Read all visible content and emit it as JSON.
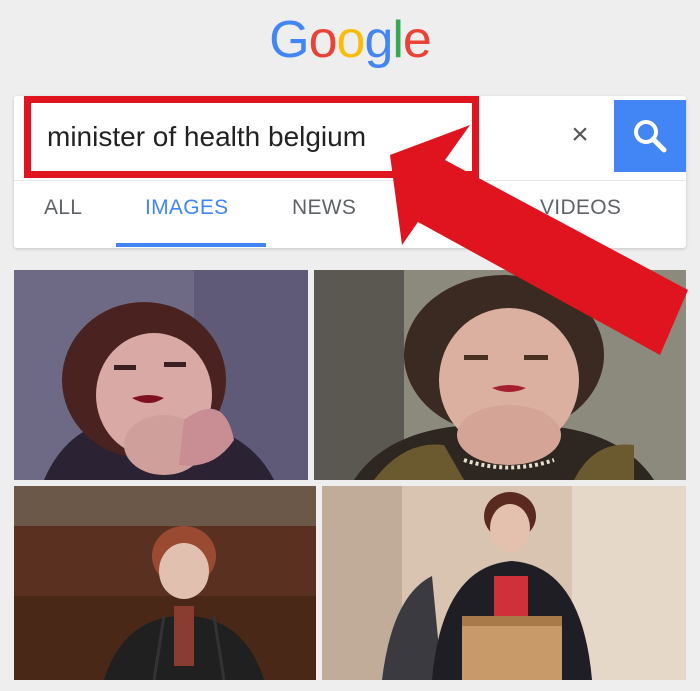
{
  "logo": {
    "letters": [
      "G",
      "o",
      "o",
      "g",
      "l",
      "e"
    ],
    "colors": [
      "#4285f4",
      "#ea4335",
      "#fbbc05",
      "#4285f4",
      "#34a853",
      "#ea4335"
    ]
  },
  "search": {
    "query": "minister of health belgium",
    "clear_label": "×"
  },
  "tabs": [
    {
      "label": "ALL"
    },
    {
      "label": "IMAGES"
    },
    {
      "label": "NEWS"
    },
    {
      "label": "VIDEOS"
    }
  ],
  "colors": {
    "accent": "#4285f4",
    "highlight": "#e0141e"
  }
}
